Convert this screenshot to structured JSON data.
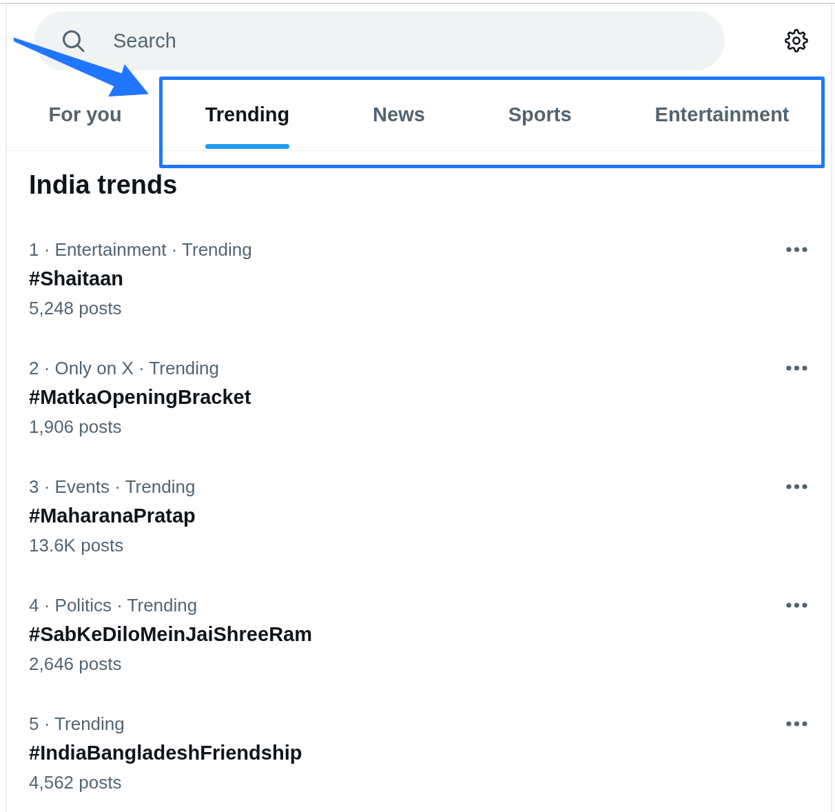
{
  "search": {
    "placeholder": "Search"
  },
  "tabs": [
    {
      "label": "For you",
      "selected": false
    },
    {
      "label": "Trending",
      "selected": true
    },
    {
      "label": "News",
      "selected": false
    },
    {
      "label": "Sports",
      "selected": false
    },
    {
      "label": "Entertainment",
      "selected": false
    }
  ],
  "section": {
    "title": "India trends"
  },
  "trends": [
    {
      "meta": "1 · Entertainment · Trending",
      "title": "#Shaitaan",
      "posts": "5,248 posts"
    },
    {
      "meta": "2 · Only on X · Trending",
      "title": "#MatkaOpeningBracket",
      "posts": "1,906 posts"
    },
    {
      "meta": "3 · Events · Trending",
      "title": "#MaharanaPratap",
      "posts": "13.6K posts"
    },
    {
      "meta": "4 · Politics · Trending",
      "title": "#SabKeDiloMeinJaiShreeRam",
      "posts": "2,646 posts"
    },
    {
      "meta": "5 · Trending",
      "title": "#IndiaBangladeshFriendship",
      "posts": "4,562 posts"
    }
  ]
}
